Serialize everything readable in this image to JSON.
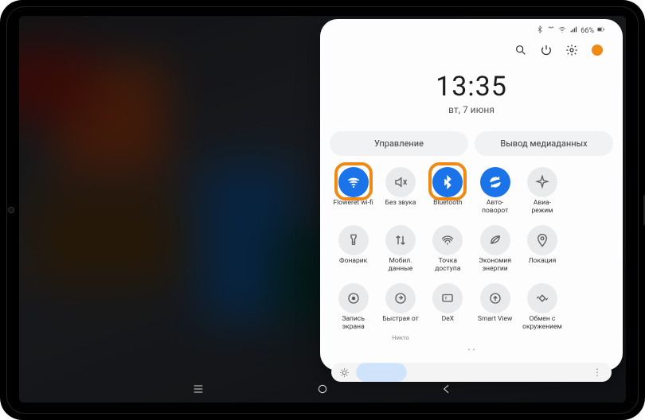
{
  "status": {
    "battery_text": "66%"
  },
  "clock": {
    "time": "13:35",
    "date": "вт, 7 июня"
  },
  "pills": {
    "left": "Управление",
    "right": "Вывод медиаданных"
  },
  "tiles": [
    {
      "id": "wifi",
      "label": "Floweret wi-fi",
      "active": true,
      "highlight": true,
      "icon": "wifi"
    },
    {
      "id": "mute",
      "label": "Без звука",
      "active": false,
      "highlight": false,
      "icon": "mute"
    },
    {
      "id": "bluetooth",
      "label": "Bluetooth",
      "active": true,
      "highlight": true,
      "icon": "bluetooth"
    },
    {
      "id": "rotate",
      "label": "Авто-\nповорот",
      "active": true,
      "highlight": false,
      "icon": "rotate"
    },
    {
      "id": "airplane",
      "label": "Авиа-\nрежим",
      "active": false,
      "highlight": false,
      "icon": "airplane"
    },
    {
      "id": "spacer5",
      "label": "",
      "active": false,
      "highlight": false,
      "icon": ""
    },
    {
      "id": "flashlight",
      "label": "Фонарик",
      "active": false,
      "highlight": false,
      "icon": "flashlight"
    },
    {
      "id": "mobiledata",
      "label": "Мобил.\nданные",
      "active": false,
      "highlight": false,
      "icon": "data"
    },
    {
      "id": "hotspot",
      "label": "Точка\nдоступа",
      "active": false,
      "highlight": false,
      "icon": "hotspot"
    },
    {
      "id": "powersave",
      "label": "Экономия\nэнергии",
      "active": false,
      "highlight": false,
      "icon": "leaf"
    },
    {
      "id": "location",
      "label": "Локация",
      "active": false,
      "highlight": false,
      "icon": "location"
    },
    {
      "id": "spacer11",
      "label": "",
      "active": false,
      "highlight": false,
      "icon": ""
    },
    {
      "id": "screenrec",
      "label": "Запись\nэкрана",
      "active": false,
      "highlight": false,
      "icon": "record"
    },
    {
      "id": "quickshare",
      "label": "Быстрая от",
      "sub": "Никто",
      "active": false,
      "highlight": false,
      "icon": "share"
    },
    {
      "id": "dex",
      "label": "DeX",
      "active": false,
      "highlight": false,
      "icon": "dex"
    },
    {
      "id": "smartview",
      "label": "Smart View",
      "active": false,
      "highlight": false,
      "icon": "cast"
    },
    {
      "id": "nearby",
      "label": "Обмен с\nокружением",
      "active": false,
      "highlight": false,
      "icon": "nearby"
    },
    {
      "id": "spacer17",
      "label": "",
      "active": false,
      "highlight": false,
      "icon": ""
    }
  ],
  "brightness": {
    "percent": 22
  }
}
